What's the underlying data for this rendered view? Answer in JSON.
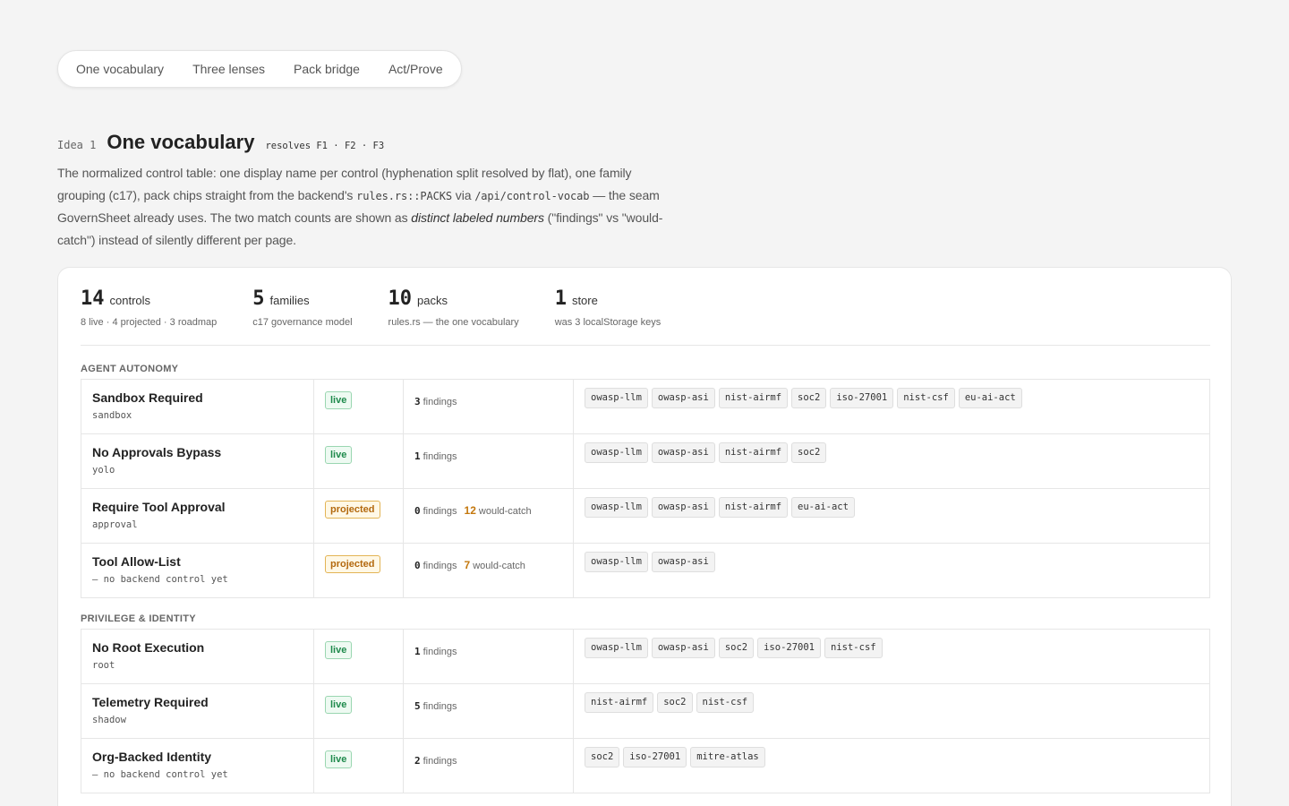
{
  "tabs": [
    "One vocabulary",
    "Three lenses",
    "Pack bridge",
    "Act/Prove"
  ],
  "idea": {
    "number": "Idea 1",
    "title": "One vocabulary",
    "resolves": "resolves F1 · F2 · F3",
    "desc_1": "The normalized control table: one display name per control (hyphenation split resolved by flat), one family grouping (c17), pack chips straight from the backend's ",
    "code_1": "rules.rs::PACKS",
    "desc_2": " via ",
    "code_2": "/api/control-vocab",
    "desc_3": " — the seam GovernSheet already uses. The two match counts are shown as ",
    "emph": "distinct labeled numbers",
    "desc_4": " (\"findings\" vs \"would-catch\") instead of silently different per page."
  },
  "stats": [
    {
      "num": "14",
      "unit": "controls",
      "sub": "8 live · 4 projected · 3 roadmap"
    },
    {
      "num": "5",
      "unit": "families",
      "sub": "c17 governance model"
    },
    {
      "num": "10",
      "unit": "packs",
      "sub": "rules.rs — the one vocabulary"
    },
    {
      "num": "1",
      "unit": "store",
      "sub": "was 3 localStorage keys"
    }
  ],
  "labels": {
    "findings": "findings",
    "would_catch": "would-catch"
  },
  "families": [
    {
      "label": "AGENT AUTONOMY",
      "controls": [
        {
          "name": "Sandbox Required",
          "key": "sandbox",
          "status": "live",
          "findings": "3",
          "would_catch": null,
          "packs": [
            "owasp-llm",
            "owasp-asi",
            "nist-airmf",
            "soc2",
            "iso-27001",
            "nist-csf",
            "eu-ai-act"
          ]
        },
        {
          "name": "No Approvals Bypass",
          "key": "yolo",
          "status": "live",
          "findings": "1",
          "would_catch": null,
          "packs": [
            "owasp-llm",
            "owasp-asi",
            "nist-airmf",
            "soc2"
          ]
        },
        {
          "name": "Require Tool Approval",
          "key": "approval",
          "status": "projected",
          "findings": "0",
          "would_catch": "12",
          "packs": [
            "owasp-llm",
            "owasp-asi",
            "nist-airmf",
            "eu-ai-act"
          ]
        },
        {
          "name": "Tool Allow-List",
          "key": "— no backend control yet",
          "status": "projected",
          "findings": "0",
          "would_catch": "7",
          "packs": [
            "owasp-llm",
            "owasp-asi"
          ]
        }
      ]
    },
    {
      "label": "PRIVILEGE & IDENTITY",
      "controls": [
        {
          "name": "No Root Execution",
          "key": "root",
          "status": "live",
          "findings": "1",
          "would_catch": null,
          "packs": [
            "owasp-llm",
            "owasp-asi",
            "soc2",
            "iso-27001",
            "nist-csf"
          ]
        },
        {
          "name": "Telemetry Required",
          "key": "shadow",
          "status": "live",
          "findings": "5",
          "would_catch": null,
          "packs": [
            "nist-airmf",
            "soc2",
            "nist-csf"
          ]
        },
        {
          "name": "Org-Backed Identity",
          "key": "— no backend control yet",
          "status": "live",
          "findings": "2",
          "would_catch": null,
          "packs": [
            "soc2",
            "iso-27001",
            "mitre-atlas"
          ]
        }
      ]
    }
  ]
}
